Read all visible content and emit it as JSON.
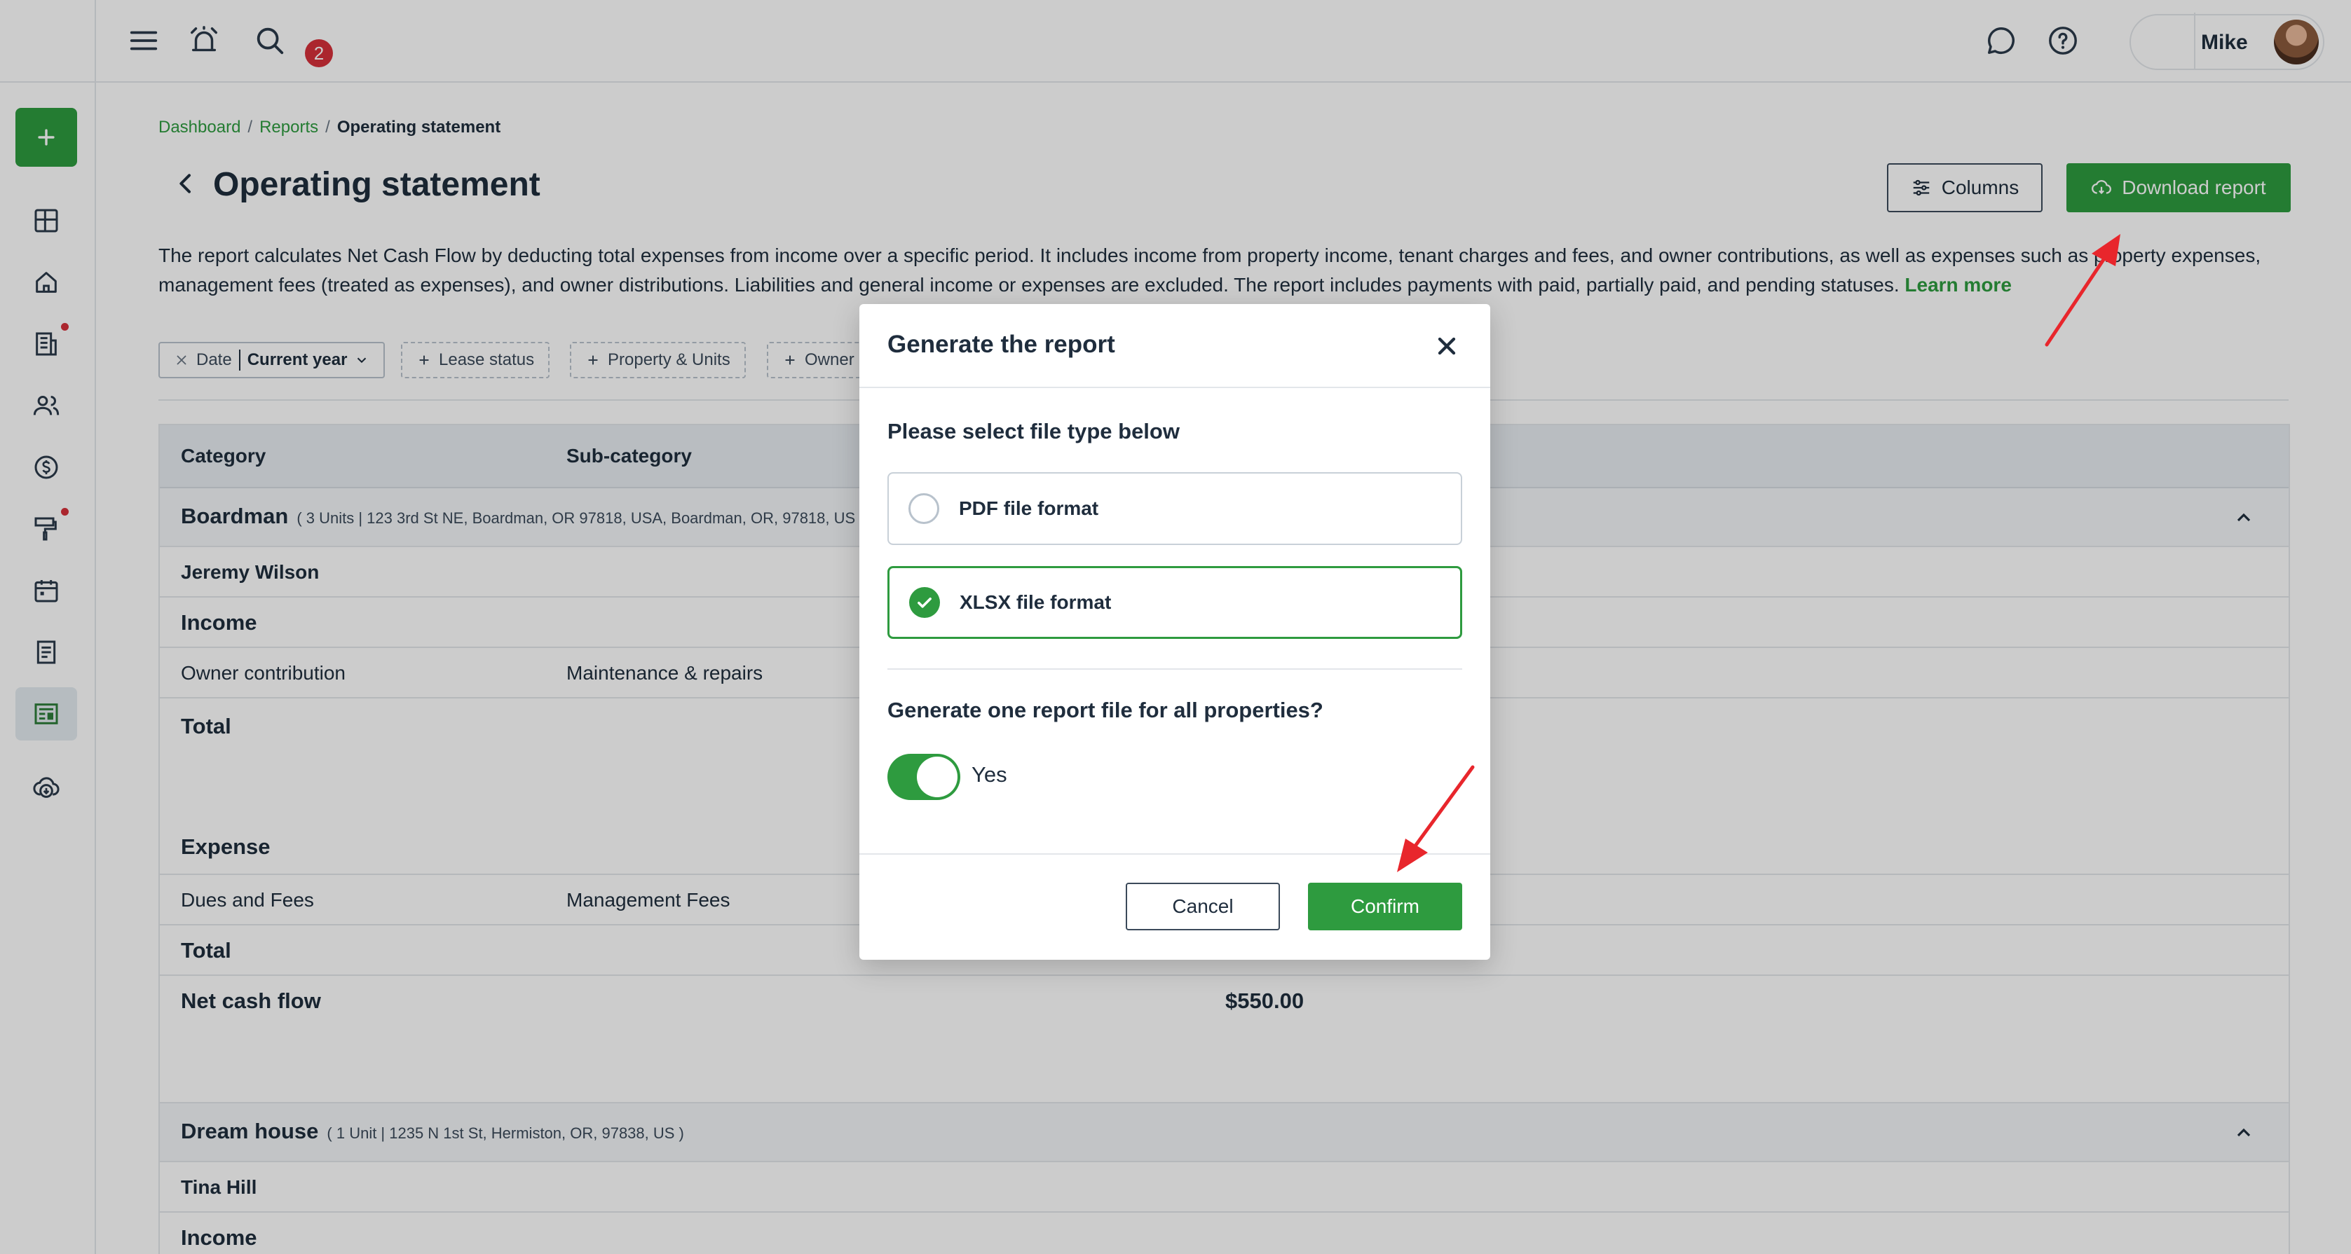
{
  "topbar": {
    "notification_count": "2",
    "user_name": "Mike"
  },
  "sidebar": {
    "items": [
      "dashboard-icon",
      "home-icon",
      "document-list-icon",
      "people-icon",
      "dollar-icon",
      "paint-roller-icon",
      "calendar-icon",
      "notes-icon",
      "report-icon",
      "cloud-download-icon"
    ]
  },
  "breadcrumb": {
    "items": [
      "Dashboard",
      "Reports"
    ],
    "current": "Operating statement",
    "separator": "/"
  },
  "page": {
    "title": "Operating statement",
    "columns_label": "Columns",
    "download_label": "Download report",
    "description": "The report calculates Net Cash Flow by deducting total expenses from income over a specific period. It includes income from property income, tenant charges and fees, and owner contributions, as well as expenses such as property expenses, management fees (treated as expenses), and owner distributions. Liabilities and general income or expenses are excluded. The report includes payments with paid, partially paid, and pending statuses.",
    "learn_more": "Learn more"
  },
  "filters": {
    "date_label": "Date",
    "date_value": "Current year",
    "lease_status": "Lease status",
    "property_units": "Property & Units",
    "owner": "Owner"
  },
  "table": {
    "headers": [
      "Category",
      "Sub-category"
    ],
    "group1": {
      "name": "Boardman",
      "details": "( 3 Units | 123 3rd St NE, Boardman, OR 97818, USA, Boardman, OR, 97818, US",
      "owner": "Jeremy Wilson",
      "income": "Income",
      "income_row": [
        "Owner contribution",
        "Maintenance & repairs"
      ],
      "total1": "Total",
      "expense": "Expense",
      "expense_row": [
        "Dues and Fees",
        "Management Fees"
      ],
      "total2": "Total",
      "net_label": "Net cash flow",
      "net_value": "$550.00"
    },
    "group2": {
      "name": "Dream house",
      "details": "( 1 Unit | 1235 N 1st St, Hermiston, OR, 97838, US )",
      "owner": "Tina Hill",
      "income": "Income"
    }
  },
  "modal": {
    "title": "Generate the report",
    "subtitle": "Please select file type below",
    "option_pdf": "PDF file format",
    "option_xlsx": "XLSX file format",
    "selected": "xlsx",
    "question": "Generate one report file for all properties?",
    "toggle_label": "Yes",
    "toggle_on": true,
    "cancel": "Cancel",
    "confirm": "Confirm"
  },
  "colors": {
    "accent": "#2e9b3f",
    "text": "#1f2d3d",
    "annotation_arrow": "#e8262c"
  }
}
